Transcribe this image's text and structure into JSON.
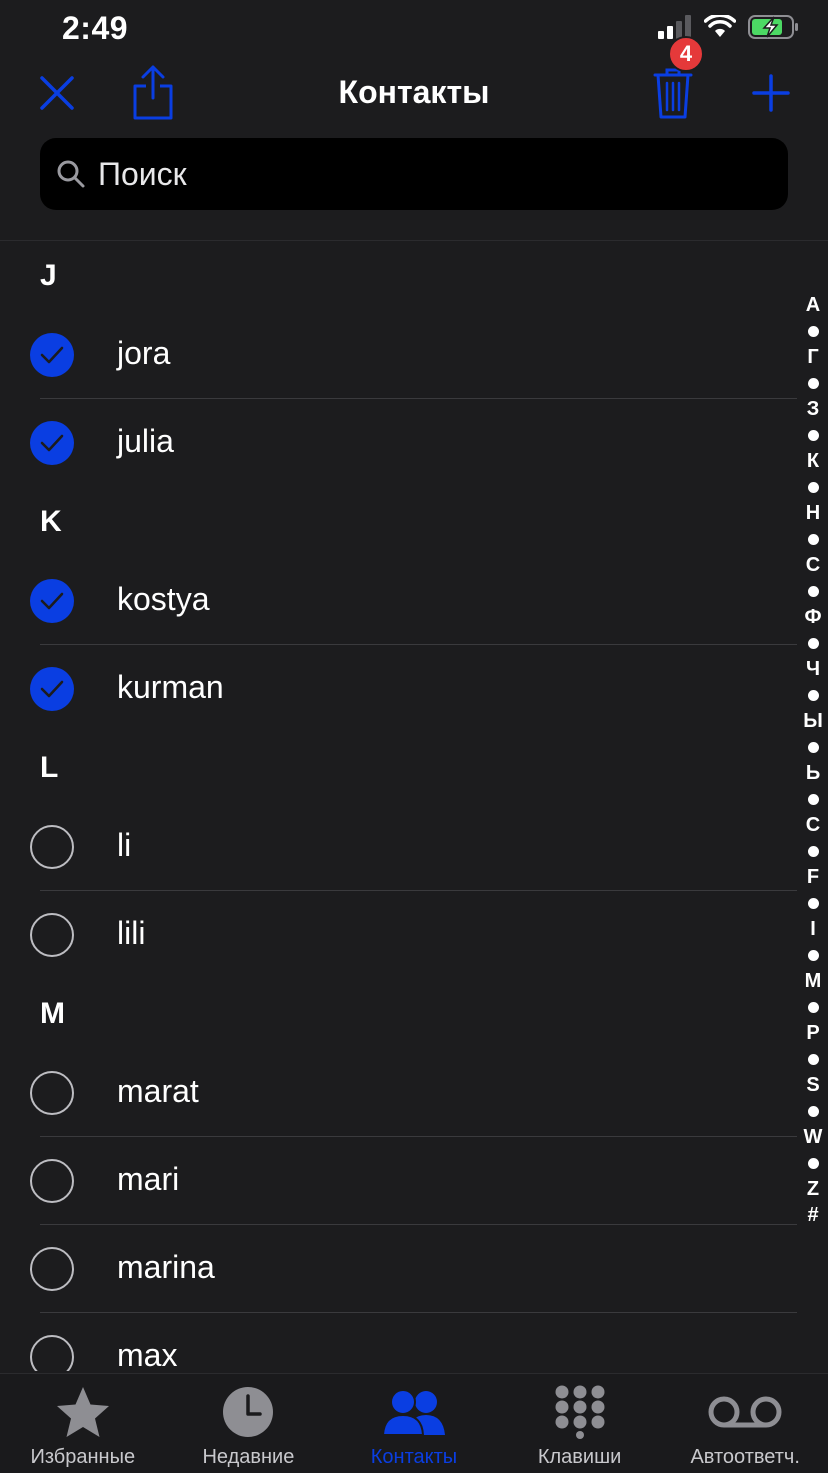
{
  "status_bar": {
    "time": "2:49"
  },
  "nav": {
    "title": "Контакты",
    "badge_count": "4"
  },
  "search": {
    "placeholder": "Поиск"
  },
  "sections": [
    {
      "letter": "J",
      "contacts": [
        {
          "name": "jora",
          "selected": true
        },
        {
          "name": "julia",
          "selected": true
        }
      ]
    },
    {
      "letter": "K",
      "contacts": [
        {
          "name": "kostya",
          "selected": true
        },
        {
          "name": "kurman",
          "selected": true
        }
      ]
    },
    {
      "letter": "L",
      "contacts": [
        {
          "name": "li",
          "selected": false
        },
        {
          "name": "lili",
          "selected": false
        }
      ]
    },
    {
      "letter": "M",
      "contacts": [
        {
          "name": "marat",
          "selected": false
        },
        {
          "name": "mari",
          "selected": false
        },
        {
          "name": "marina",
          "selected": false
        },
        {
          "name": "max",
          "selected": false
        }
      ]
    }
  ],
  "index": [
    "А",
    "•",
    "Г",
    "•",
    "З",
    "•",
    "К",
    "•",
    "Н",
    "•",
    "С",
    "•",
    "Ф",
    "•",
    "Ч",
    "•",
    "Ы",
    "•",
    "Ь",
    "•",
    "C",
    "•",
    "F",
    "•",
    "I",
    "•",
    "M",
    "•",
    "P",
    "•",
    "S",
    "•",
    "W",
    "•",
    "Z",
    "#"
  ],
  "tabs": [
    {
      "label": "Избранные",
      "icon": "star-icon",
      "active": false
    },
    {
      "label": "Недавние",
      "icon": "clock-icon",
      "active": false
    },
    {
      "label": "Контакты",
      "icon": "contacts-icon",
      "active": true
    },
    {
      "label": "Клавиши",
      "icon": "keypad-icon",
      "active": false
    },
    {
      "label": "Автоответч.",
      "icon": "voicemail-icon",
      "active": false
    }
  ],
  "colors": {
    "accent": "#0a3ee2",
    "badge": "#e5393a",
    "background": "#1c1c1e",
    "battery": "#4cd964"
  }
}
